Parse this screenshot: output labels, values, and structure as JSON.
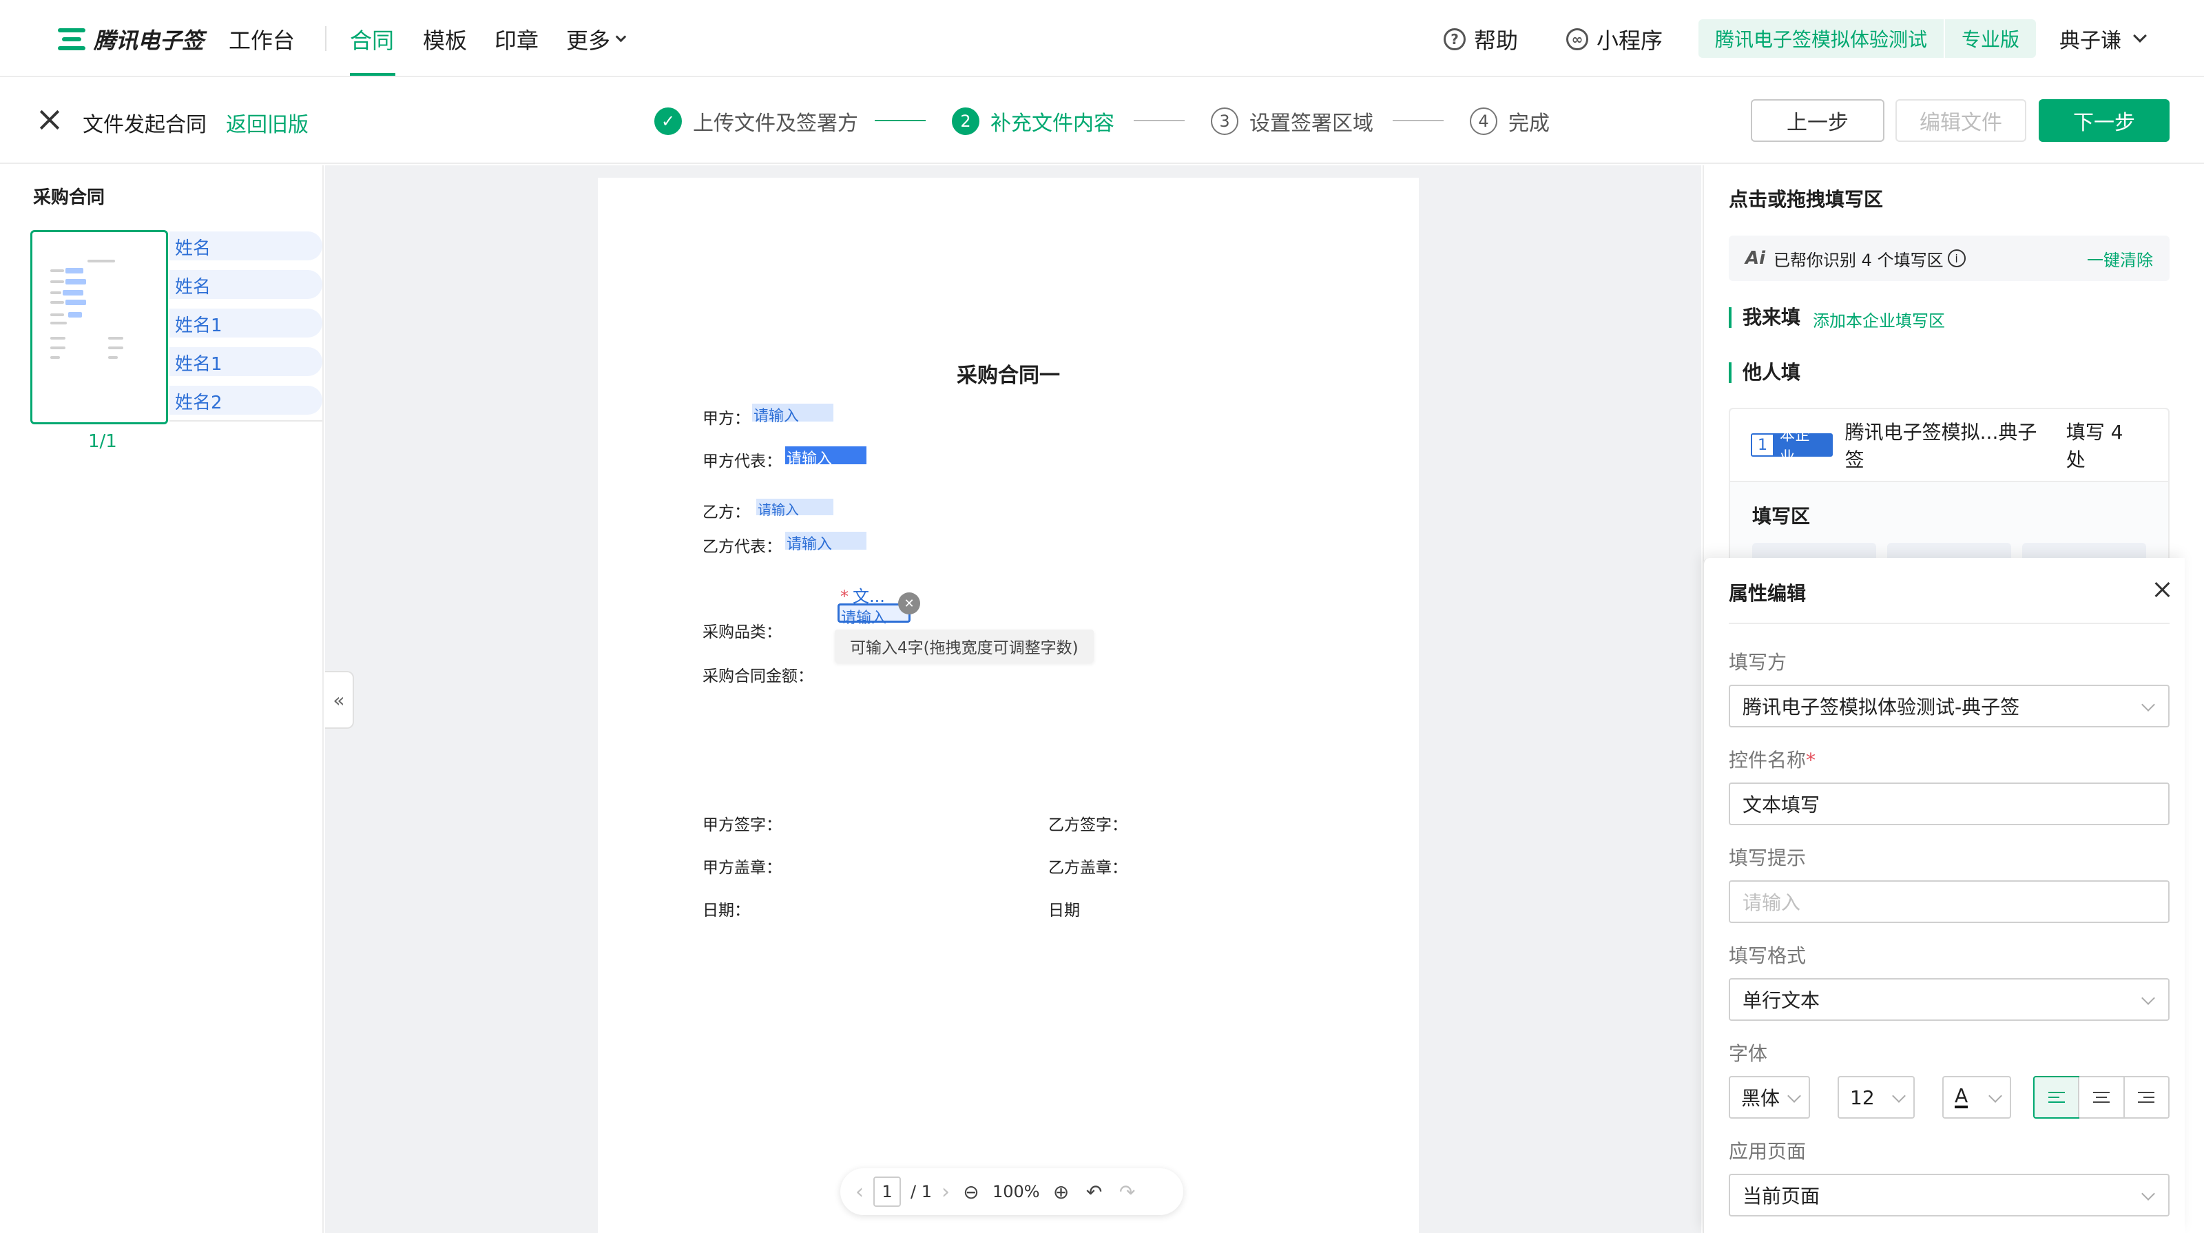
{
  "topnav": {
    "brand": "腾讯电子签",
    "workbench": "工作台",
    "tabs": [
      "合同",
      "模板",
      "印章",
      "更多"
    ],
    "help": "帮助",
    "miniprogram": "小程序",
    "enterprise": "腾讯电子签模拟体验测试",
    "edition": "专业版",
    "user": "典子谦"
  },
  "stepbar": {
    "title": "文件发起合同",
    "back_old": "返回旧版",
    "steps": [
      {
        "num": "✓",
        "label": "上传文件及签署方"
      },
      {
        "num": "2",
        "label": "补充文件内容"
      },
      {
        "num": "3",
        "label": "设置签署区域"
      },
      {
        "num": "4",
        "label": "完成"
      }
    ],
    "prev": "上一步",
    "edit_file": "编辑文件",
    "next": "下一步"
  },
  "leftpanel": {
    "title": "采购合同",
    "page_label": "1/1",
    "tags": [
      "姓名",
      "姓名",
      "姓名1",
      "姓名1",
      "姓名2"
    ]
  },
  "document": {
    "title": "采购合同一",
    "lines": {
      "party_a": "甲方：",
      "party_a_rep": "甲方代表：",
      "party_b": "乙方：",
      "party_b_rep": "乙方代表：",
      "category": "采购品类：",
      "amount": "采购合同金额：",
      "a_sign": "甲方签字：",
      "b_sign": "乙方签字：",
      "a_seal": "甲方盖章：",
      "b_seal": "乙方盖章：",
      "a_date": "日期：",
      "b_date": "日期"
    },
    "placeholder": "请输入",
    "active_label": "文...",
    "required_mark": "*",
    "tooltip": "可输入4字(拖拽宽度可调整字数)"
  },
  "pager": {
    "current": "1",
    "total": "/ 1",
    "zoom": "100%"
  },
  "rightpanel": {
    "header": "点击或拖拽填写区",
    "ai_label": "Ai",
    "ai_text": "已帮你识别 4 个填写区",
    "clear": "一键清除",
    "self_fill": "我来填",
    "add_enterprise": "添加本企业填写区",
    "others_fill": "他人填",
    "party": {
      "num": "1",
      "type": "本企业",
      "name": "腾讯电子签模拟...典子签",
      "count": "填写 4 处"
    },
    "fill_zone": "填写区"
  },
  "properties": {
    "title": "属性编辑",
    "filler_label": "填写方",
    "filler_value": "腾讯电子签模拟体验测试-典子签",
    "control_name_label": "控件名称",
    "required_mark": "*",
    "control_name_value": "文本填写",
    "hint_label": "填写提示",
    "hint_placeholder": "请输入",
    "format_label": "填写格式",
    "format_value": "单行文本",
    "font_label": "字体",
    "font_family": "黑体",
    "font_size": "12",
    "font_color_glyph": "A",
    "apply_label": "应用页面",
    "apply_value": "当前页面"
  },
  "colors": {
    "accent": "#00a870",
    "field_blue": "#2d6fd6",
    "field_bg": "#d8e6fd"
  }
}
